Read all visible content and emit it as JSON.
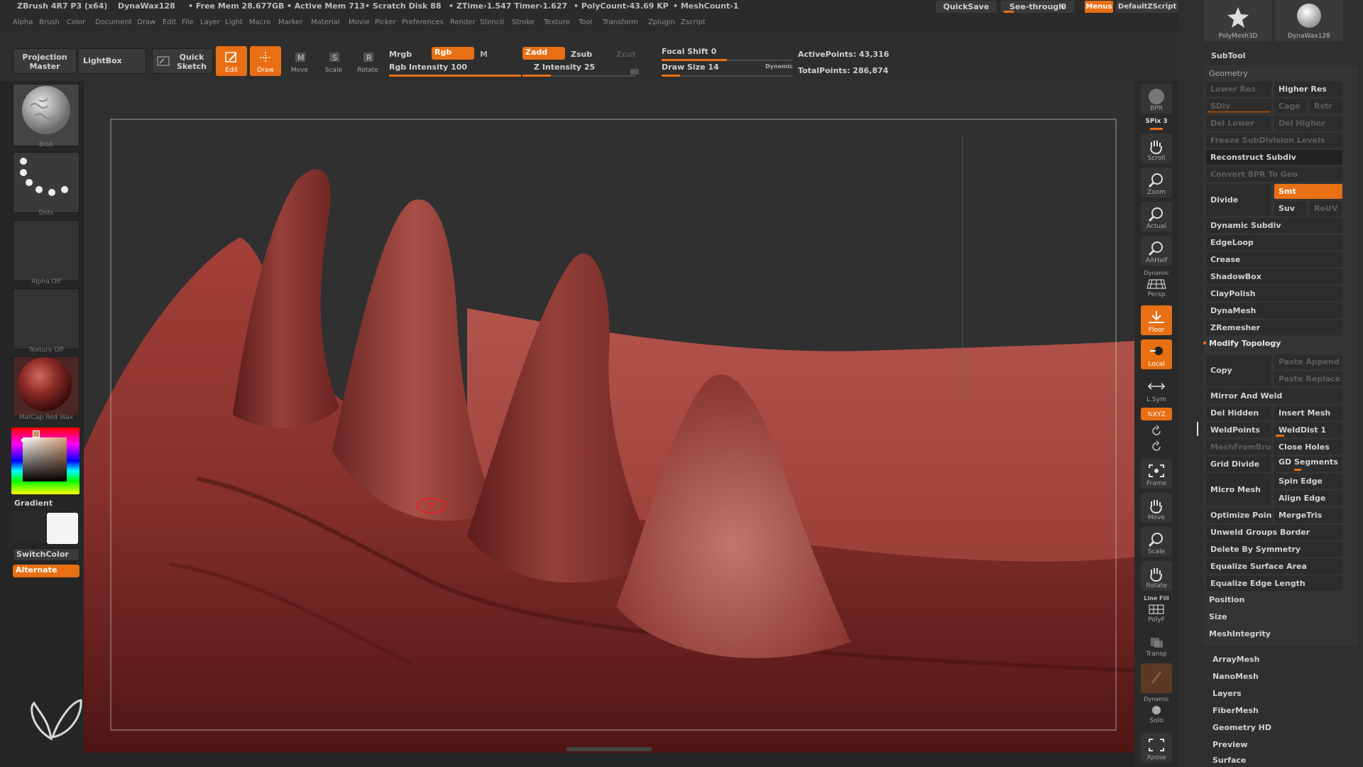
{
  "title": {
    "app": "ZBrush 4R7 P3 (x64)",
    "document": "DynaWax128",
    "free_mem": "• Free Mem 28.677GB",
    "active_mem": "• Active Mem 713",
    "scratch_disk": "• Scratch Disk 88",
    "ztime": "• ZTime›1.547 Timer›1.627",
    "polycount": "• PolyCount›43.69 KP",
    "meshcount": "• MeshCount›1",
    "quicksave": "QuickSave",
    "see_through": "See-through",
    "see_through_value": "0",
    "menus": "Menus",
    "script": "DefaultZScript"
  },
  "menu": [
    "Alpha",
    "Brush",
    "Color",
    "Document",
    "Draw",
    "Edit",
    "File",
    "Layer",
    "Light",
    "Macro",
    "Marker",
    "Material",
    "Movie",
    "Picker",
    "Preferences",
    "Render",
    "Stencil",
    "Stroke",
    "Texture",
    "Tool",
    "Transform",
    "Zplugin",
    "Zscript"
  ],
  "shelf": {
    "projection_master": "Projection Master",
    "lightbox": "LightBox",
    "quick_sketch": "Quick Sketch",
    "tools": [
      {
        "label": "Edit",
        "icon": "edit-icon",
        "active": true
      },
      {
        "label": "Draw",
        "icon": "draw-icon",
        "active": true
      },
      {
        "label": "Move",
        "icon": "move-icon",
        "active": false
      },
      {
        "label": "Scale",
        "icon": "scale-icon",
        "active": false
      },
      {
        "label": "Rotate",
        "icon": "rotate-icon",
        "active": false
      }
    ],
    "mrgb": "Mrgb",
    "rgb": "Rgb",
    "m": "M",
    "rgb_intensity": "Rgb Intensity 100",
    "zadd": "Zadd",
    "zsub": "Zsub",
    "zcut": "Zcut",
    "z_intensity": "Z Intensity 25",
    "focal_shift": "Focal Shift 0",
    "draw_size": "Draw Size 14",
    "dynamic": "Dynamic",
    "active_points": "ActivePoints: 43,316",
    "total_points": "TotalPoints: 286,874",
    "levels": {
      "rgb_intensity": 1.0,
      "z_intensity": 0.25,
      "focal_shift": 0.5,
      "draw_size": 0.14
    }
  },
  "left": {
    "brush": "Blob",
    "stroke": "Dots",
    "alpha": "Alpha Off",
    "texture": "Texture Off",
    "material": "MatCap Red Wax",
    "gradient": "Gradient",
    "switch_color": "SwitchColor",
    "alternate": "Alternate"
  },
  "rightbar": {
    "bpr": "BPR",
    "spix": "SPix 3",
    "scroll": "Scroll",
    "zoom": "Zoom",
    "actual": "Actual",
    "aahalf": "AAHalf",
    "dynamic": "Dynamic",
    "persp": "Persp",
    "floor": "Floor",
    "local": "Local",
    "lsym": "L.Sym",
    "xyz": "↻XYZ",
    "frame": "Frame",
    "move": "Move",
    "scale": "Scale",
    "rotate": "Rotate",
    "line_fill": "Line Fill",
    "polyf": "PolyF",
    "transp": "Transp",
    "dynamic2": "Dynamic",
    "solo": "Solo",
    "xpose": "Xpose"
  },
  "palette": {
    "tool_polymesh": "PolyMesh3D",
    "tool_dynawax": "DynaWax128",
    "subtool": "SubTool",
    "geometry": "Geometry",
    "lower_res": "Lower Res",
    "higher_res": "Higher Res",
    "sdiv": "SDiv",
    "cage": "Cage",
    "rstr": "Rstr",
    "del_lower": "Del Lower",
    "del_higher": "Del Higher",
    "freeze": "Freeze SubDivision Levels",
    "reconstruct": "Reconstruct Subdiv",
    "convert_bpr": "Convert BPR To Geo",
    "divide": "Divide",
    "smt": "Smt",
    "suv": "Suv",
    "reuv": "ReUV",
    "dynamic_subdiv": "Dynamic Subdiv",
    "edgeloop": "EdgeLoop",
    "crease": "Crease",
    "shadowbox": "ShadowBox",
    "claypolish": "ClayPolish",
    "dynamesh": "DynaMesh",
    "zremesher": "ZRemesher",
    "modify_topology": "Modify Topology",
    "copy": "Copy",
    "paste_append": "Paste Append",
    "paste_replace": "Paste Replace",
    "mirror_weld": "Mirror And Weld",
    "del_hidden": "Del Hidden",
    "insert_mesh": "Insert Mesh",
    "weldpoints": "WeldPoints",
    "welddist": "WeldDist 1",
    "meshfrombrush": "MeshFromBrush",
    "close_holes": "Close Holes",
    "grid_divide": "Grid Divide",
    "gd_segments": "GD Segments",
    "micro_mesh": "Micro Mesh",
    "spin_edge": "Spin Edge",
    "align_edge": "Align Edge",
    "optimize_points": "Optimize Points",
    "mergetris": "MergeTris",
    "unweld_groups": "Unweld Groups Border",
    "delete_symmetry": "Delete By Symmetry",
    "equalize_surface": "Equalize Surface Area",
    "equalize_edge": "Equalize Edge Length",
    "position": "Position",
    "size": "Size",
    "meshintegrity": "MeshIntegrity",
    "arraymesh": "ArrayMesh",
    "nanomesh": "NanoMesh",
    "layers": "Layers",
    "fibermesh": "FiberMesh",
    "geometry_hd": "Geometry HD",
    "preview": "Preview",
    "surface": "Surface"
  },
  "colors": {
    "accent": "#e86f14",
    "wax": "#8a2a26"
  }
}
